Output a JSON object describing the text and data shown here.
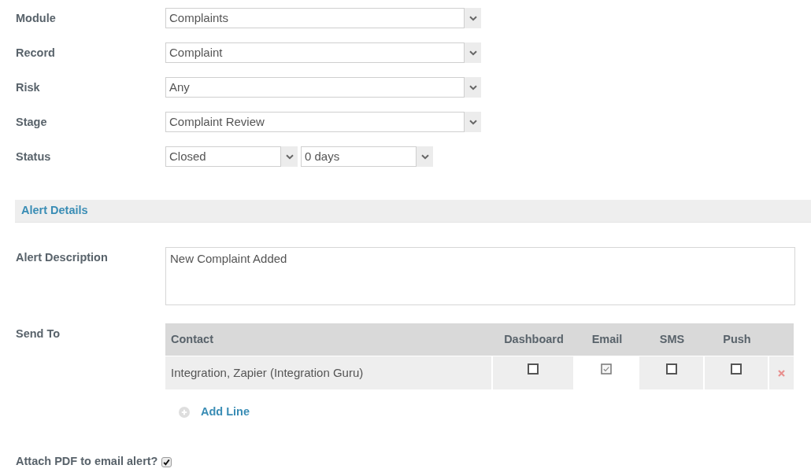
{
  "filters": [
    {
      "label": "Module",
      "selects": [
        {
          "value": "Complaints"
        }
      ]
    },
    {
      "label": "Record",
      "selects": [
        {
          "value": "Complaint"
        }
      ]
    },
    {
      "label": "Risk",
      "selects": [
        {
          "value": "Any"
        }
      ]
    },
    {
      "label": "Stage",
      "selects": [
        {
          "value": "Complaint Review"
        }
      ]
    },
    {
      "label": "Status",
      "selects": [
        {
          "value": "Closed"
        },
        {
          "value": "0 days"
        }
      ]
    }
  ],
  "section": {
    "title": "Alert Details"
  },
  "alert_description": {
    "label": "Alert Description",
    "value": "New Complaint Added"
  },
  "send_to": {
    "label": "Send To",
    "columns": [
      "Contact",
      "Dashboard",
      "Email",
      "SMS",
      "Push"
    ],
    "rows": [
      {
        "contact": "Integration, Zapier (Integration Guru)",
        "channels": [
          {
            "checked": false
          },
          {
            "checked": true
          },
          {
            "checked": false
          },
          {
            "checked": false
          }
        ]
      }
    ],
    "add_line": "Add Line"
  },
  "attach_pdf": {
    "label": "Attach PDF to email alert?",
    "checked": true
  }
}
